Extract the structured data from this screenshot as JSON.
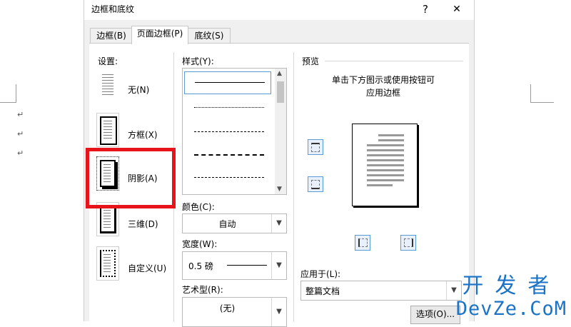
{
  "dialog": {
    "title": "边框和底纹",
    "help_label": "?",
    "close_label": "✕",
    "tabs": [
      {
        "label": "边框(B)"
      },
      {
        "label": "页面边框(P)"
      },
      {
        "label": "底纹(S)"
      }
    ],
    "settings": {
      "heading": "设置:",
      "items": [
        {
          "label": "无(N)"
        },
        {
          "label": "方框(X)"
        },
        {
          "label": "阴影(A)"
        },
        {
          "label": "三维(D)"
        },
        {
          "label": "自定义(U)"
        }
      ],
      "selected": "阴影(A)"
    },
    "style": {
      "heading": "样式(Y):",
      "line_styles": [
        "solid",
        "dotted",
        "dashed",
        "dashed-long",
        "dash-dot"
      ]
    },
    "color": {
      "label": "颜色(C):",
      "value": "自动"
    },
    "width": {
      "label": "宽度(W):",
      "value": "0.5 磅"
    },
    "art": {
      "label": "艺术型(R):",
      "value": "(无)"
    },
    "preview": {
      "heading": "预览",
      "hint_line1": "单击下方图示或使用按钮可",
      "hint_line2": "应用边框"
    },
    "apply_to": {
      "label": "应用于(L):",
      "value": "整篇文档"
    },
    "options_button": "选项(O)...",
    "highlight_color": "#e8141c"
  },
  "document": {
    "paragraph_mark": "↵"
  },
  "watermark": {
    "line1": "开发者",
    "line2": "DevZe.CoM"
  }
}
